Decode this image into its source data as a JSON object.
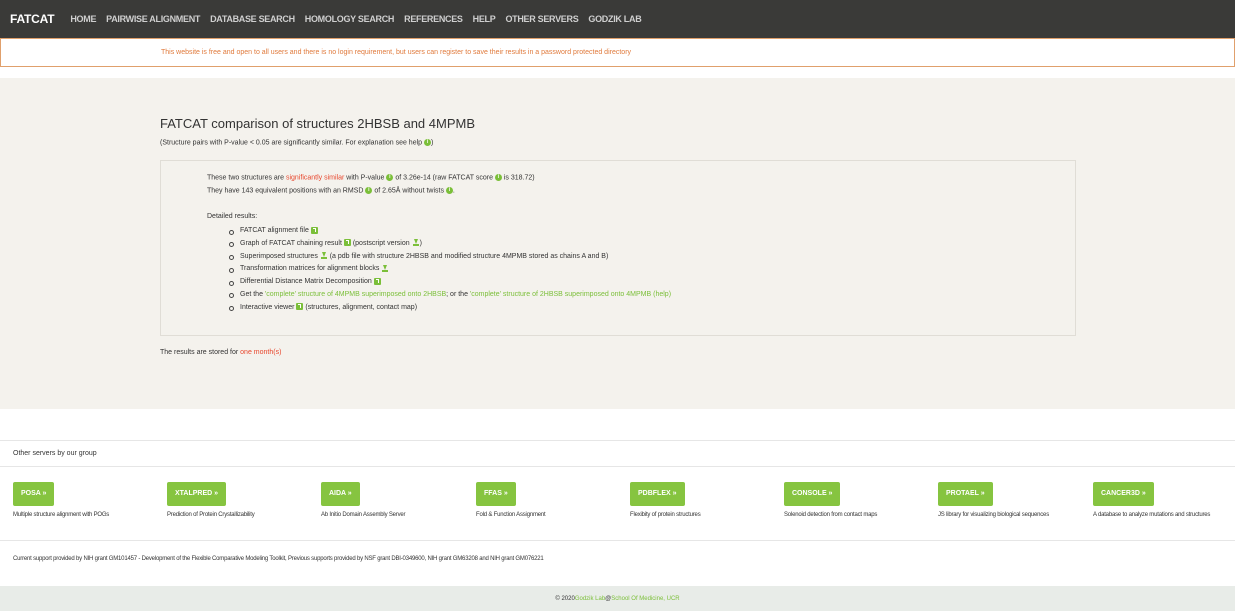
{
  "navbar": {
    "brand": "FATCAT",
    "items": [
      "HOME",
      "PAIRWISE ALIGNMENT",
      "DATABASE SEARCH",
      "HOMOLOGY SEARCH",
      "REFERENCES",
      "HELP",
      "OTHER SERVERS",
      "GODZIK LAB"
    ]
  },
  "alert": "This website is free and open to all users and there is no login requirement, but users can register to save their results in a password protected directory",
  "main": {
    "title": "FATCAT comparison of structures 2HBSB and 4MPMB",
    "subtitle": "(Structure pairs with P-value < 0.05 are significantly similar. For explanation see help",
    "subtitle_end": ")",
    "summary": {
      "l1_a": "These two structures are ",
      "l1_sig": "significantly similar",
      "l1_b": " with P-value ",
      "l1_c": " of 3.26e-14 (raw FATCAT score ",
      "l1_d": " is 318.72)",
      "l2_a": "They have 143 equivalent positions with an RMSD ",
      "l2_b": " of 2.65Å without twists ",
      "l2_c": "."
    },
    "detailed_label": "Detailed results:",
    "results": {
      "r1": "FATCAT alignment file",
      "r2_a": "Graph of FATCAT chaining result",
      "r2_b": " (postscript version ",
      "r2_c": ")",
      "r3_a": "Superimposed structures",
      "r3_b": " (a pdb file with structure 2HBSB and modified structure 4MPMB stored as chains A and B)",
      "r4": "Transformation matrices for alignment blocks",
      "r5": "Differential Distance Matrix Decomposition",
      "r6_a": "Get the ",
      "r6_link1": "'complete' structure of 4MPMB superimposed onto 2HBSB",
      "r6_b": "; or the ",
      "r6_link2": "'complete' structure of 2HBSB superimposed onto 4MPMB",
      "r6_c": " ",
      "r6_help": "(help)",
      "r7_a": "Interactive viewer",
      "r7_b": " (structures, alignment, contact map)"
    },
    "stored_a": "The results are stored for ",
    "stored_b": "one month(s)"
  },
  "servers_heading": "Other servers by our group",
  "servers": [
    {
      "name": "POSA »",
      "desc": "Multiple structure alignment with POGs"
    },
    {
      "name": "XTALPRED »",
      "desc": "Prediction of Protein Crystallizability"
    },
    {
      "name": "AIDA »",
      "desc": "Ab Initio Domain Assembly Server"
    },
    {
      "name": "FFAS »",
      "desc": "Fold & Function Assignment"
    },
    {
      "name": "PDBFLEX »",
      "desc": "Flexibity of protein structures"
    },
    {
      "name": "CONSOLE »",
      "desc": "Solenoid detection from contact maps"
    },
    {
      "name": "PROTAEL »",
      "desc": "JS library for visualizing biological sequences"
    },
    {
      "name": "CANCER3D »",
      "desc": "A database to analyze mutations and structures"
    }
  ],
  "support": "Current support provided by NIH grant GM101457 - Development of the Flexible Comparative Modeling Toolkit, Previous supports provided by NSF grant DBI-0349600, NIH grant GM63208 and NIH grant GM076221",
  "footer": {
    "copy": "© 2020 ",
    "lab": "Godzik Lab",
    "at": " @ ",
    "school": "School Of Medicine, UCR"
  },
  "colors": {
    "accent": "#7bbf39",
    "button": "#86c440",
    "warn": "#e8462c",
    "navbar": "#3a3a38",
    "band": "#f4f2ed"
  }
}
